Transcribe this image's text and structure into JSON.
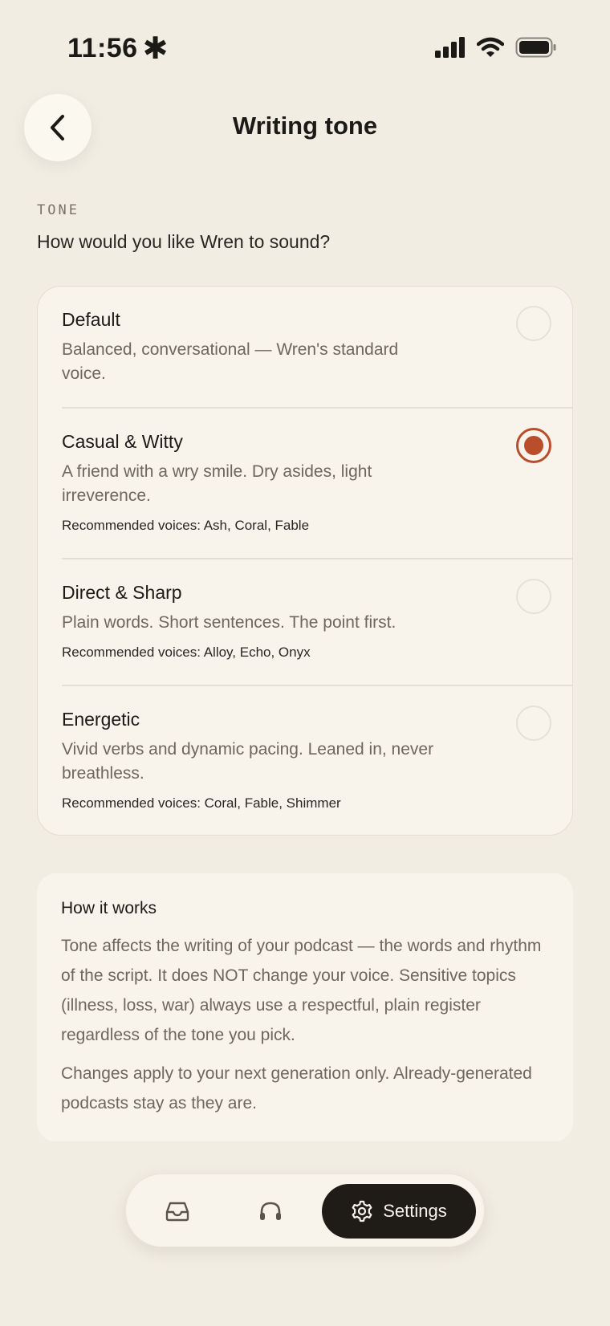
{
  "status_bar": {
    "time": "11:56",
    "time_glyph": "✱",
    "icons": [
      "cellular-signal-icon",
      "wifi-icon",
      "battery-icon"
    ]
  },
  "header": {
    "title": "Writing tone",
    "back_icon": "chevron-left-icon"
  },
  "section": {
    "label": "TONE",
    "question": "How would you like Wren to sound?"
  },
  "tone_options": [
    {
      "name": "Default",
      "description": "Balanced, conversational — Wren's standard voice.",
      "voices": "",
      "selected": false
    },
    {
      "name": "Casual & Witty",
      "description": "A friend with a wry smile. Dry asides, light irreverence.",
      "voices": "Recommended voices: Ash, Coral, Fable",
      "selected": true
    },
    {
      "name": "Direct & Sharp",
      "description": "Plain words. Short sentences. The point first.",
      "voices": "Recommended voices: Alloy, Echo, Onyx",
      "selected": false
    },
    {
      "name": "Energetic",
      "description": "Vivid verbs and dynamic pacing. Leaned in, never breathless.",
      "voices": "Recommended voices: Coral, Fable, Shimmer",
      "selected": false
    }
  ],
  "info": {
    "title": "How it works",
    "paragraph_1": "Tone affects the writing of your podcast — the words and rhythm of the script. It does NOT change your voice. Sensitive topics (illness, loss, war) always use a respectful, plain register regardless of the tone you pick.",
    "paragraph_2": "Changes apply to your next generation only. Already-generated podcasts stay as they are."
  },
  "bottom_nav": {
    "inbox_icon": "inbox-icon",
    "listen_icon": "headphones-icon",
    "settings_icon": "gear-icon",
    "settings_label": "Settings",
    "active": "Settings"
  },
  "colors": {
    "background": "#f1ede3",
    "card": "#f8f4eb",
    "accent": "#b84e2c",
    "nav_active": "#1f1b17"
  }
}
